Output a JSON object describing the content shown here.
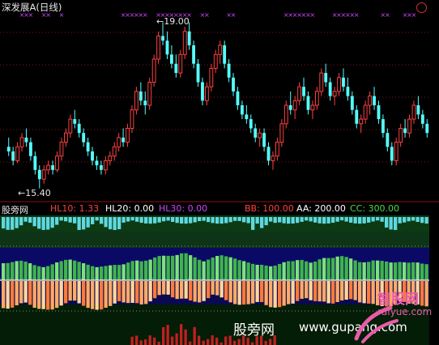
{
  "title": {
    "stock_name": "深发展A",
    "period": "(日线)"
  },
  "price_labels": {
    "high": "19.00",
    "low": "15.40"
  },
  "indicator": {
    "name": "股旁网",
    "items": [
      {
        "label": "HL10: 1.33",
        "color": "#ff4040"
      },
      {
        "label": "HL20: 0.00",
        "color": "#ffffff"
      },
      {
        "label": "HL30: 0.00",
        "color": "#cc44ff"
      },
      {
        "label": "BB: 100.00",
        "color": "#ff4040"
      },
      {
        "label": "AA: 200.00",
        "color": "#ffffff"
      },
      {
        "label": "CC: 300.00",
        "color": "#44dd44"
      }
    ]
  },
  "watermark": {
    "cn": "股旁网",
    "en": "www.gupang.com"
  },
  "logo": {
    "cn": "智股网",
    "en": "raiyue.com"
  },
  "colors": {
    "up": "#ff4040",
    "down": "#54ffff",
    "marker": "#cc44ff",
    "grid": "#7a1a1a"
  },
  "chart_data": {
    "type": "candlestick",
    "price_range": [
      15.2,
      19.2
    ],
    "candles": [
      [
        16.3,
        16.5,
        16.1,
        16.2
      ],
      [
        16.2,
        16.3,
        15.9,
        16.0
      ],
      [
        16.0,
        16.4,
        15.95,
        16.3
      ],
      [
        16.3,
        16.6,
        16.2,
        16.5
      ],
      [
        16.5,
        16.7,
        16.3,
        16.4
      ],
      [
        16.4,
        16.5,
        16.0,
        16.1
      ],
      [
        16.1,
        16.2,
        15.7,
        15.8
      ],
      [
        15.8,
        15.9,
        15.4,
        15.6
      ],
      [
        15.6,
        15.9,
        15.5,
        15.8
      ],
      [
        15.8,
        16.0,
        15.7,
        15.9
      ],
      [
        15.9,
        16.0,
        15.7,
        15.8
      ],
      [
        15.8,
        16.2,
        15.75,
        16.1
      ],
      [
        16.1,
        16.5,
        16.0,
        16.4
      ],
      [
        16.4,
        16.7,
        16.3,
        16.6
      ],
      [
        16.6,
        17.0,
        16.5,
        16.9
      ],
      [
        16.9,
        17.1,
        16.7,
        16.8
      ],
      [
        16.8,
        16.9,
        16.5,
        16.6
      ],
      [
        16.6,
        16.7,
        16.3,
        16.4
      ],
      [
        16.4,
        16.5,
        16.1,
        16.2
      ],
      [
        16.2,
        16.3,
        15.9,
        16.0
      ],
      [
        16.0,
        16.1,
        15.8,
        15.9
      ],
      [
        15.9,
        16.0,
        15.7,
        15.8
      ],
      [
        15.8,
        16.1,
        15.7,
        16.0
      ],
      [
        16.0,
        16.2,
        15.9,
        16.1
      ],
      [
        16.1,
        16.4,
        16.0,
        16.3
      ],
      [
        16.3,
        16.6,
        16.2,
        16.5
      ],
      [
        16.5,
        16.7,
        16.3,
        16.4
      ],
      [
        16.4,
        16.8,
        16.3,
        16.7
      ],
      [
        16.7,
        17.2,
        16.6,
        17.1
      ],
      [
        17.1,
        17.6,
        17.0,
        17.5
      ],
      [
        17.5,
        17.7,
        17.2,
        17.3
      ],
      [
        17.3,
        17.5,
        17.0,
        17.2
      ],
      [
        17.2,
        17.8,
        17.1,
        17.7
      ],
      [
        17.7,
        18.3,
        17.6,
        18.2
      ],
      [
        18.2,
        18.8,
        18.1,
        18.7
      ],
      [
        18.7,
        19.0,
        18.5,
        18.6
      ],
      [
        18.6,
        18.8,
        18.2,
        18.3
      ],
      [
        18.3,
        18.5,
        18.0,
        18.1
      ],
      [
        18.1,
        18.3,
        17.8,
        17.9
      ],
      [
        17.9,
        18.4,
        17.8,
        18.3
      ],
      [
        18.3,
        18.9,
        18.2,
        18.8
      ],
      [
        18.8,
        19.0,
        18.4,
        18.5
      ],
      [
        18.5,
        18.6,
        18.0,
        18.1
      ],
      [
        18.1,
        18.2,
        17.6,
        17.7
      ],
      [
        17.7,
        17.8,
        17.2,
        17.3
      ],
      [
        17.3,
        17.7,
        17.2,
        17.6
      ],
      [
        17.6,
        18.1,
        17.5,
        18.0
      ],
      [
        18.0,
        18.4,
        17.9,
        18.3
      ],
      [
        18.3,
        18.6,
        18.1,
        18.5
      ],
      [
        18.5,
        18.6,
        18.0,
        18.1
      ],
      [
        18.1,
        18.2,
        17.7,
        17.8
      ],
      [
        17.8,
        17.9,
        17.4,
        17.5
      ],
      [
        17.5,
        17.6,
        17.1,
        17.2
      ],
      [
        17.2,
        17.3,
        16.9,
        17.0
      ],
      [
        17.0,
        17.2,
        16.8,
        16.9
      ],
      [
        16.9,
        17.0,
        16.6,
        16.7
      ],
      [
        16.7,
        16.8,
        16.4,
        16.5
      ],
      [
        16.5,
        16.7,
        16.3,
        16.6
      ],
      [
        16.6,
        16.7,
        16.2,
        16.3
      ],
      [
        16.3,
        16.4,
        15.9,
        16.0
      ],
      [
        16.0,
        16.2,
        15.8,
        16.1
      ],
      [
        16.1,
        16.5,
        16.0,
        16.4
      ],
      [
        16.4,
        16.9,
        16.3,
        16.8
      ],
      [
        16.8,
        17.3,
        16.7,
        17.2
      ],
      [
        17.2,
        17.5,
        17.0,
        17.1
      ],
      [
        17.1,
        17.4,
        16.9,
        17.3
      ],
      [
        17.3,
        17.7,
        17.2,
        17.6
      ],
      [
        17.6,
        17.8,
        17.3,
        17.4
      ],
      [
        17.4,
        17.5,
        17.0,
        17.1
      ],
      [
        17.1,
        17.3,
        16.9,
        17.2
      ],
      [
        17.2,
        17.6,
        17.1,
        17.5
      ],
      [
        17.5,
        18.0,
        17.4,
        17.9
      ],
      [
        17.9,
        18.1,
        17.6,
        17.7
      ],
      [
        17.7,
        17.8,
        17.3,
        17.4
      ],
      [
        17.4,
        17.6,
        17.2,
        17.5
      ],
      [
        17.5,
        17.9,
        17.4,
        17.8
      ],
      [
        17.8,
        18.0,
        17.5,
        17.6
      ],
      [
        17.6,
        17.8,
        17.3,
        17.4
      ],
      [
        17.4,
        17.5,
        17.0,
        17.1
      ],
      [
        17.1,
        17.2,
        16.7,
        16.8
      ],
      [
        16.8,
        17.0,
        16.6,
        16.9
      ],
      [
        16.9,
        17.3,
        16.8,
        17.2
      ],
      [
        17.2,
        17.5,
        17.0,
        17.4
      ],
      [
        17.4,
        17.6,
        17.1,
        17.2
      ],
      [
        17.2,
        17.3,
        16.8,
        16.9
      ],
      [
        16.9,
        17.0,
        16.5,
        16.6
      ],
      [
        16.6,
        16.7,
        16.2,
        16.3
      ],
      [
        16.3,
        16.4,
        15.9,
        16.0
      ],
      [
        16.0,
        16.5,
        15.9,
        16.4
      ],
      [
        16.4,
        16.8,
        16.3,
        16.7
      ],
      [
        16.7,
        16.9,
        16.5,
        16.6
      ],
      [
        16.6,
        17.0,
        16.5,
        16.9
      ],
      [
        16.9,
        17.3,
        16.8,
        17.2
      ],
      [
        17.2,
        17.4,
        16.9,
        17.0
      ],
      [
        17.0,
        17.1,
        16.7,
        16.8
      ],
      [
        16.8,
        16.9,
        16.5,
        16.6
      ]
    ]
  }
}
